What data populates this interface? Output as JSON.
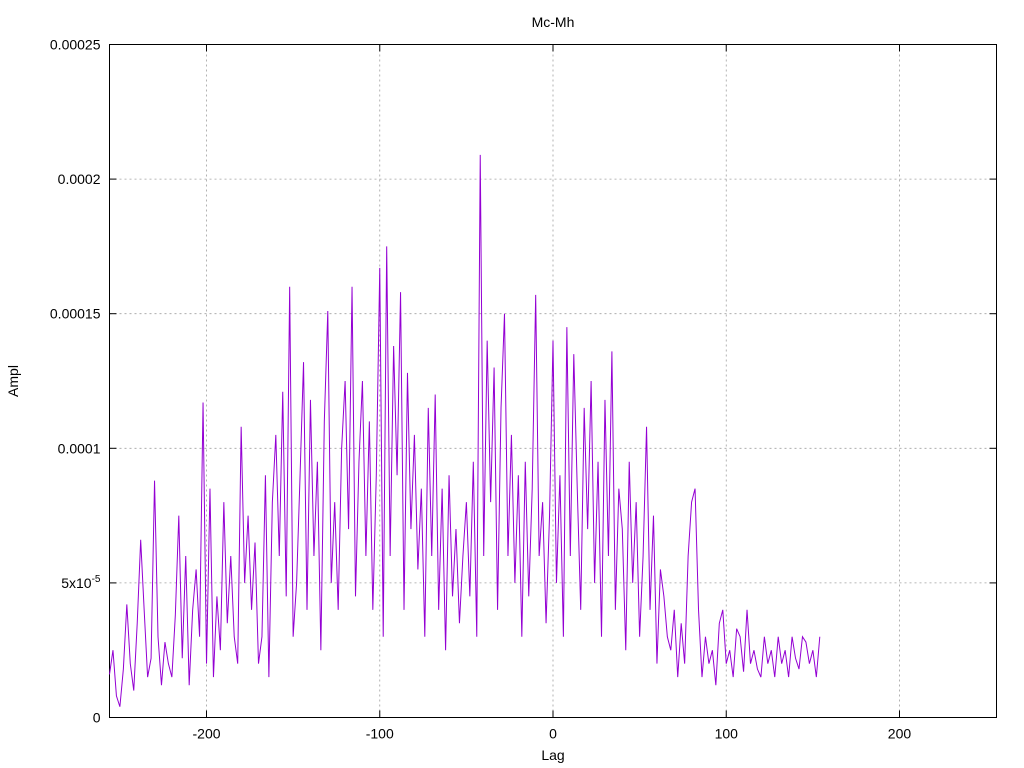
{
  "chart_data": {
    "type": "line",
    "title": "Mc-Mh",
    "xlabel": "Lag",
    "ylabel": "Ampl",
    "xlim": [
      -256,
      256
    ],
    "ylim": [
      0,
      0.00025
    ],
    "grid": true,
    "legend": "none",
    "colors": {
      "series": "#9400d3",
      "grid": "#a0a0a0",
      "axis": "#000000"
    },
    "xticks": [
      {
        "value": -200,
        "label": "-200"
      },
      {
        "value": -100,
        "label": "-100"
      },
      {
        "value": 0,
        "label": "0"
      },
      {
        "value": 100,
        "label": "100"
      },
      {
        "value": 200,
        "label": "200"
      }
    ],
    "yticks": [
      {
        "value": 0,
        "label": "0",
        "sup": ""
      },
      {
        "value": 5e-05,
        "label": "5x10",
        "sup": "-5"
      },
      {
        "value": 0.0001,
        "label": "0.0001",
        "sup": ""
      },
      {
        "value": 0.00015,
        "label": "0.00015",
        "sup": ""
      },
      {
        "value": 0.0002,
        "label": "0.0002",
        "sup": ""
      },
      {
        "value": 0.00025,
        "label": "0.00025",
        "sup": ""
      }
    ],
    "series": [
      {
        "x_start": -256,
        "x_step": 2,
        "values": [
          1.6e-05,
          2.5e-05,
          8e-06,
          4e-06,
          1.8e-05,
          4.2e-05,
          2e-05,
          1e-05,
          3.5e-05,
          6.6e-05,
          4e-05,
          1.5e-05,
          2.2e-05,
          8.8e-05,
          3e-05,
          1.2e-05,
          2.8e-05,
          2e-05,
          1.5e-05,
          3.8e-05,
          7.5e-05,
          2.2e-05,
          6e-05,
          1.2e-05,
          4e-05,
          5.5e-05,
          3e-05,
          0.000117,
          2e-05,
          8.5e-05,
          1.5e-05,
          4.5e-05,
          2.5e-05,
          8e-05,
          3.5e-05,
          6e-05,
          3e-05,
          2e-05,
          0.000108,
          5e-05,
          7.5e-05,
          4e-05,
          6.5e-05,
          2e-05,
          3e-05,
          9e-05,
          1.5e-05,
          8e-05,
          0.000105,
          6e-05,
          0.000121,
          4.5e-05,
          0.00016,
          3e-05,
          5e-05,
          9e-05,
          0.000132,
          4e-05,
          0.000118,
          6e-05,
          9.5e-05,
          2.5e-05,
          0.00011,
          0.000151,
          5e-05,
          8e-05,
          4e-05,
          0.0001,
          0.000125,
          7e-05,
          0.00016,
          4.5e-05,
          9.5e-05,
          0.000125,
          6e-05,
          0.00011,
          4e-05,
          9e-05,
          0.000167,
          3e-05,
          0.000175,
          6e-05,
          0.000138,
          9e-05,
          0.000158,
          4e-05,
          0.000128,
          7e-05,
          0.000105,
          5.5e-05,
          8.5e-05,
          3e-05,
          0.000115,
          6e-05,
          0.00012,
          4e-05,
          8.5e-05,
          2.5e-05,
          9e-05,
          4.5e-05,
          7e-05,
          3.5e-05,
          6e-05,
          8e-05,
          4.5e-05,
          9.5e-05,
          3e-05,
          0.000209,
          6e-05,
          0.00014,
          8e-05,
          0.00013,
          4e-05,
          0.000115,
          0.00015,
          6e-05,
          0.000105,
          5e-05,
          9e-05,
          3e-05,
          9.5e-05,
          4.5e-05,
          8.5e-05,
          0.000157,
          6e-05,
          8e-05,
          3.5e-05,
          7.5e-05,
          0.00014,
          5e-05,
          9e-05,
          3e-05,
          0.000145,
          6e-05,
          0.000135,
          8.5e-05,
          4e-05,
          0.000115,
          7e-05,
          0.000125,
          5e-05,
          9.5e-05,
          3e-05,
          0.000118,
          6e-05,
          0.000136,
          4e-05,
          8.5e-05,
          7e-05,
          2.5e-05,
          9.5e-05,
          5e-05,
          8e-05,
          3e-05,
          6e-05,
          0.000108,
          4e-05,
          7.5e-05,
          2e-05,
          5.5e-05,
          4.5e-05,
          3e-05,
          2.5e-05,
          4e-05,
          1.5e-05,
          3.5e-05,
          2e-05,
          6e-05,
          8e-05,
          8.5e-05,
          4e-05,
          1.5e-05,
          3e-05,
          2e-05,
          2.5e-05,
          1.2e-05,
          3.5e-05,
          4e-05,
          2e-05,
          2.5e-05,
          1.5e-05,
          3.3e-05,
          3e-05,
          1.7e-05,
          4e-05,
          2e-05,
          2.5e-05,
          1.8e-05,
          1.5e-05,
          3e-05,
          2e-05,
          2.5e-05,
          1.5e-05,
          3e-05,
          2e-05,
          2.5e-05,
          1.5e-05,
          3e-05,
          2.2e-05,
          1.8e-05,
          3e-05,
          2.8e-05,
          2e-05,
          2.5e-05,
          1.5e-05,
          3e-05
        ]
      }
    ]
  }
}
